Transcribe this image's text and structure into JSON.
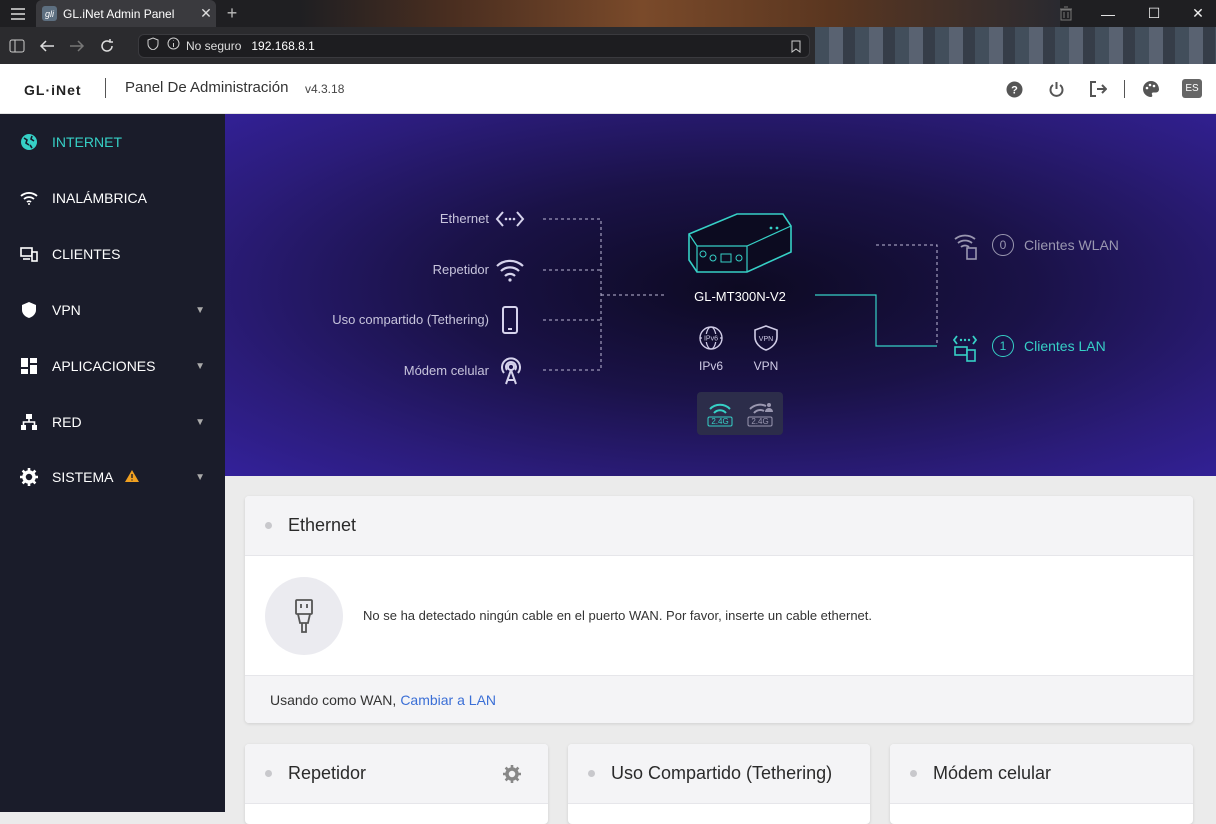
{
  "browser": {
    "tab_title": "GL.iNet Admin Panel",
    "favicon_text": "gli",
    "security_label": "No seguro",
    "url": "192.168.8.1"
  },
  "header": {
    "logo": "GL·iNet",
    "title": "Panel De Administración",
    "version": "v4.3.18",
    "lang": "ES"
  },
  "sidebar": {
    "items": [
      {
        "label": "INTERNET",
        "icon": "globe-icon",
        "active": true
      },
      {
        "label": "INALÁMBRICA",
        "icon": "wifi-icon"
      },
      {
        "label": "CLIENTES",
        "icon": "devices-icon"
      },
      {
        "label": "VPN",
        "icon": "shield-icon"
      },
      {
        "label": "APLICACIONES",
        "icon": "apps-grid-icon"
      },
      {
        "label": "RED",
        "icon": "network-icon"
      },
      {
        "label": "SISTEMA",
        "icon": "gear-icon",
        "warning": true
      }
    ]
  },
  "topology": {
    "wan": [
      "Ethernet",
      "Repetidor",
      "Uso compartido (Tethering)",
      "Módem celular"
    ],
    "device_name": "GL-MT300N-V2",
    "ipv6_label": "IPv6",
    "vpn_label": "VPN",
    "wifi_badges": [
      "2.4G",
      "2.4G"
    ],
    "wlan_count": "0",
    "wlan_label": "Clientes WLAN",
    "lan_count": "1",
    "lan_label": "Clientes LAN",
    "accent_color": "#36d0c6"
  },
  "ethernet_card": {
    "title": "Ethernet",
    "message": "No se ha detectado ningún cable en el puerto WAN. Por favor, inserte un cable ethernet.",
    "footer_text": "Usando como WAN,",
    "footer_link": "Cambiar a LAN"
  },
  "cards": {
    "repetidor": "Repetidor",
    "tethering": "Uso Compartido (Tethering)",
    "modem": "Módem celular"
  }
}
